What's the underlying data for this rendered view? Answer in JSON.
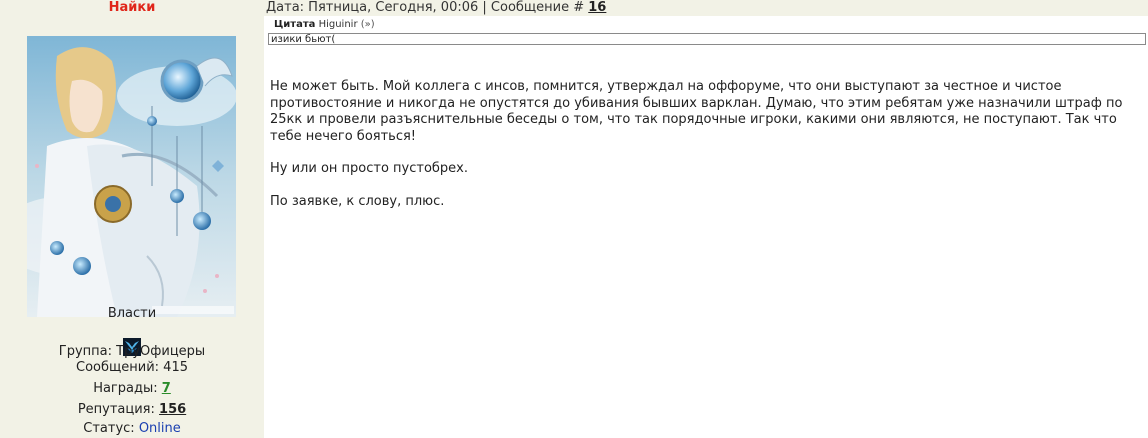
{
  "author": {
    "name": "Найки",
    "rank_title": "Власти",
    "group_label": "Группа:",
    "group": "ТруОфицеры",
    "posts_label": "Сообщений:",
    "posts": "415",
    "awards_label": "Награды:",
    "awards": "7",
    "reputation_label": "Репутация:",
    "reputation": "156",
    "status_label": "Статус:",
    "status": "Online",
    "avatar_icon": "fantasy-portrait-avatar",
    "rank_icon": "blue-wings-icon"
  },
  "post_meta": {
    "date_text": "Дата: Пятница, Сегодня, 00:06 | Сообщение # ",
    "number": "16"
  },
  "quote": {
    "label": "Цитата",
    "author": "Higuinir",
    "link": "(»)",
    "text": "изики бьют("
  },
  "post_body": {
    "paragraphs": [
      "Не может быть. Мой коллега с инсов, помнится, утверждал на оффоруме, что они выступают за честное и чистое противостояние и никогда не опустятся до убивания бывших варклан. Думаю, что этим ребятам уже назначили штраф по 25кк и провели разъяснительные беседы о том, что так порядочные игроки, какими они являются, не поступают. Так что тебе нечего бояться!",
      "Ну или он просто пустобрех.",
      "По заявке, к слову, плюс."
    ]
  },
  "colors": {
    "author_name": "#e0261a",
    "sidebar_bg": "#f2f2e6",
    "online": "#1a3fb0",
    "awards_link": "#2a8c2a"
  }
}
